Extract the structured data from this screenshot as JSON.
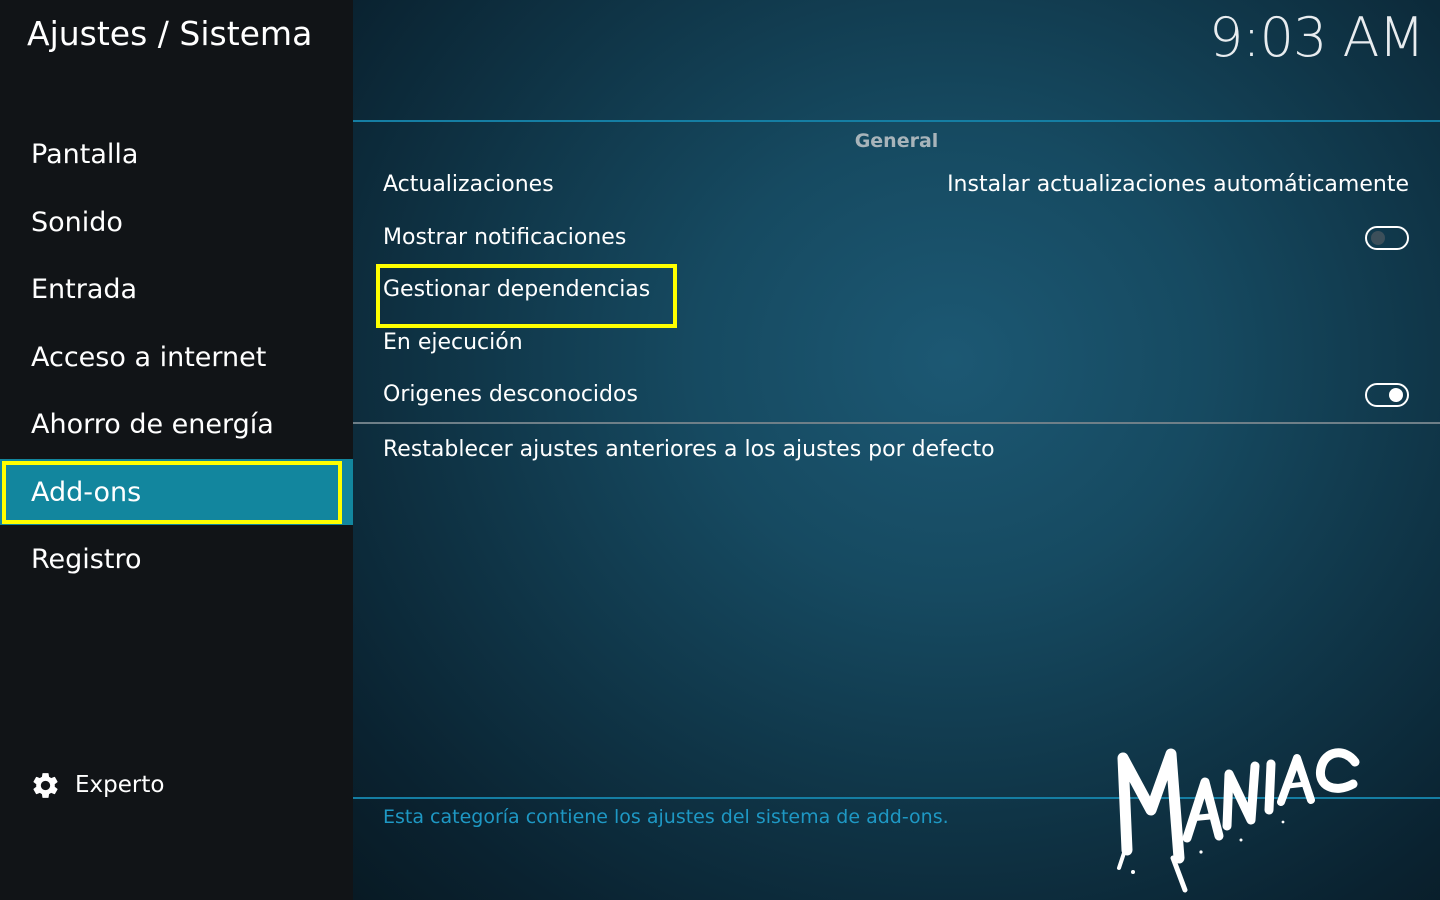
{
  "header": {
    "title": "Ajustes / Sistema",
    "clock": "9:03 AM"
  },
  "sidebar": {
    "items": [
      {
        "label": "Pantalla"
      },
      {
        "label": "Sonido"
      },
      {
        "label": "Entrada"
      },
      {
        "label": "Acceso a internet"
      },
      {
        "label": "Ahorro de energía"
      },
      {
        "label": "Add-ons",
        "selected": true
      },
      {
        "label": "Registro"
      }
    ],
    "level_label": "Experto",
    "level_icon": "gear-icon"
  },
  "main": {
    "section_header": "General",
    "settings": [
      {
        "label": "Actualizaciones",
        "value": "Instalar actualizaciones automáticamente"
      },
      {
        "label": "Mostrar notificaciones",
        "toggle": false
      },
      {
        "label": "Gestionar dependencias",
        "highlighted": true
      },
      {
        "label": "En ejecución"
      },
      {
        "label": "Origenes desconocidos",
        "toggle": true
      }
    ],
    "reset_label": "Restablecer ajustes anteriores a los ajustes por defecto",
    "description": "Esta categoría contiene los ajustes del sistema de add-ons."
  },
  "watermark": {
    "text": "MANIAC"
  },
  "colors": {
    "highlight": "#ffff00",
    "selected_bg": "#12869e",
    "accent_line": "#157ea3",
    "description_text": "#1e98c4"
  }
}
